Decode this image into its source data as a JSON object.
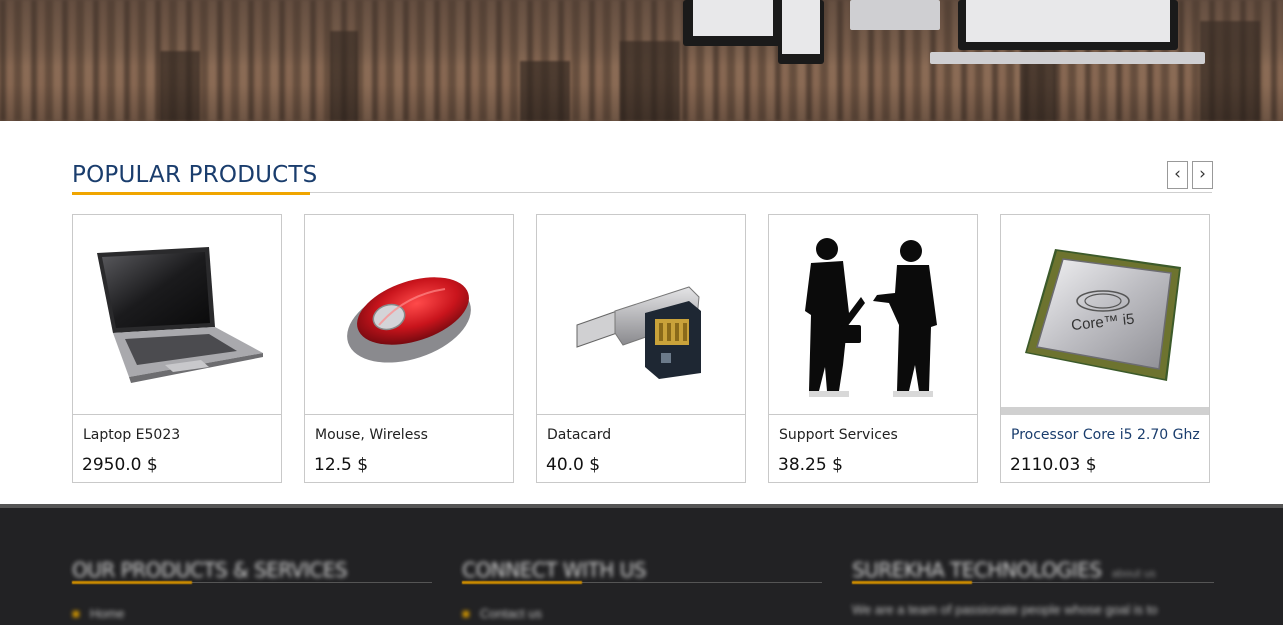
{
  "section": {
    "title": "POPULAR PRODUCTS",
    "prev_label": "‹",
    "next_label": "›"
  },
  "products": [
    {
      "name": "Laptop E5023",
      "price": "2950.0 $",
      "icon": "laptop-image"
    },
    {
      "name": "Mouse, Wireless",
      "price": "12.5 $",
      "icon": "wireless-mouse-image"
    },
    {
      "name": "Datacard",
      "price": "40.0 $",
      "icon": "datacard-image"
    },
    {
      "name": "Support Services",
      "price": "38.25 $",
      "icon": "support-services-image"
    },
    {
      "name": "Processor Core i5 2.70 Ghz",
      "price": "2110.03 $",
      "icon": "processor-image"
    }
  ],
  "cpu_label": "Core™ i5",
  "footer": {
    "col1": {
      "title": "OUR PRODUCTS & SERVICES",
      "link": "Home"
    },
    "col2": {
      "title": "CONNECT WITH US",
      "link": "Contact us"
    },
    "col3": {
      "title": "SUREKHA TECHNOLOGIES",
      "subtitle": "about us",
      "text": "We are a team of passionate people whose goal is to"
    }
  },
  "colors": {
    "title": "#1a3d6d",
    "accent": "#f0a500",
    "footer_bg": "#222224"
  }
}
